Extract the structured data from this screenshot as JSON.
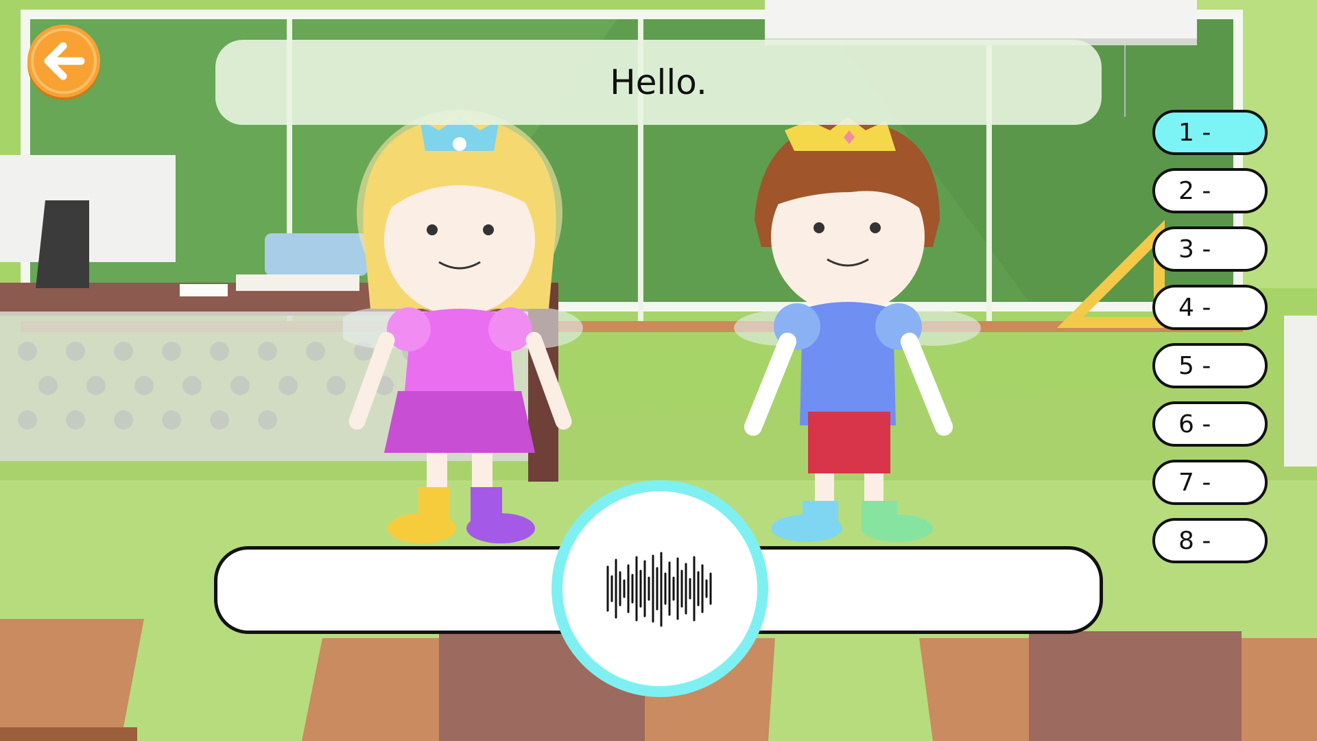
{
  "header": {
    "sentence": "Hello."
  },
  "navigation": {
    "back_icon": "arrow-left-icon"
  },
  "line_list": {
    "items": [
      {
        "label": "1 -",
        "selected": true
      },
      {
        "label": "2 -",
        "selected": false
      },
      {
        "label": "3 -",
        "selected": false
      },
      {
        "label": "4 -",
        "selected": false
      },
      {
        "label": "5 -",
        "selected": false
      },
      {
        "label": "6 -",
        "selected": false
      },
      {
        "label": "7 -",
        "selected": false
      },
      {
        "label": "8 -",
        "selected": false
      }
    ]
  },
  "answer": {
    "value": ""
  },
  "record": {
    "icon": "sound-wave-icon"
  },
  "colors": {
    "accent": "#7ff0f2",
    "back_button": "#f7a233",
    "chalkboard": "#5e9e4e"
  }
}
